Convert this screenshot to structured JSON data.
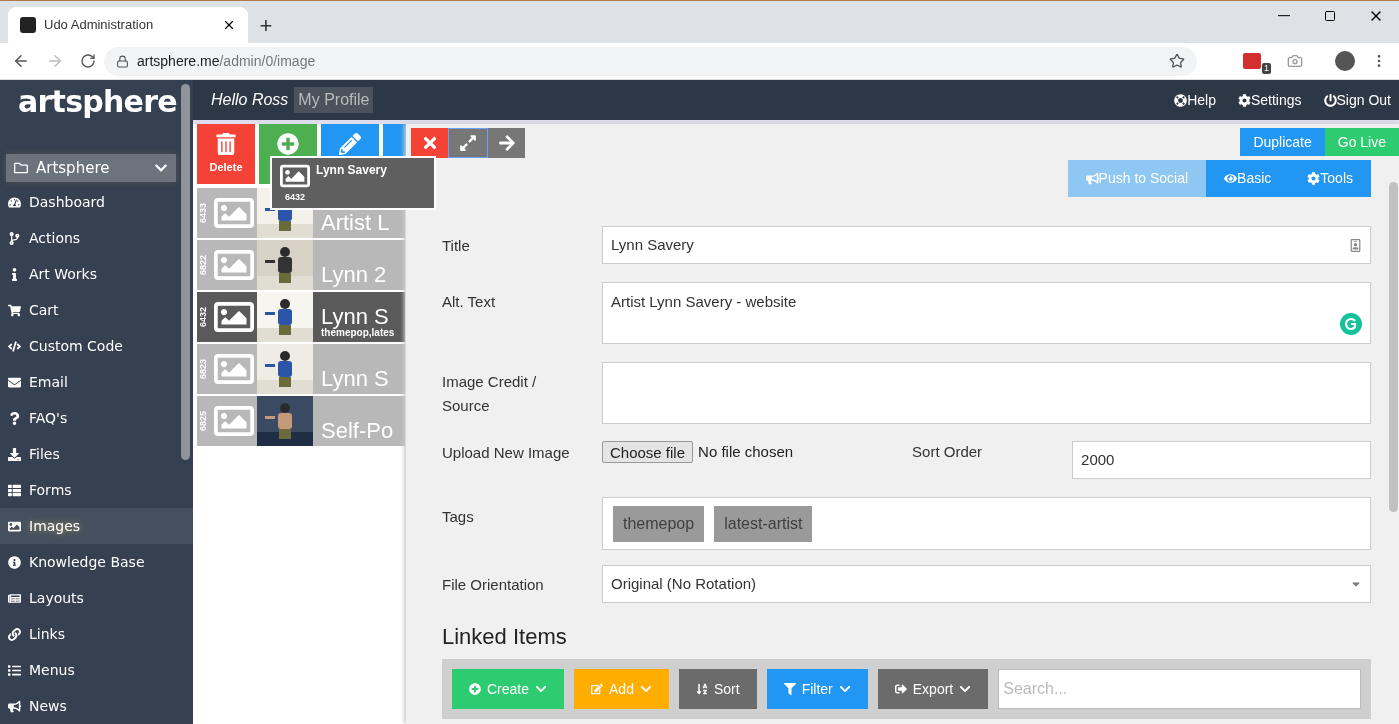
{
  "browser": {
    "tab_title": "Udo Administration",
    "new_tab": "+",
    "url_host": "artsphere.me",
    "url_path": "/admin/0/image",
    "extension_badge": "1"
  },
  "header": {
    "logo": "artsphere",
    "greeting": "Hello Ross",
    "profile_link": "My Profile",
    "actions": [
      {
        "label": "Help"
      },
      {
        "label": "Settings"
      },
      {
        "label": "Sign Out"
      }
    ]
  },
  "sidebar": {
    "workspace": "Artsphere",
    "items": [
      {
        "label": "Dashboard",
        "selected": false
      },
      {
        "label": "Actions",
        "selected": false
      },
      {
        "label": "Art Works",
        "selected": false
      },
      {
        "label": "Cart",
        "selected": false
      },
      {
        "label": "Custom Code",
        "selected": false
      },
      {
        "label": "Email",
        "selected": false
      },
      {
        "label": "FAQ's",
        "selected": false
      },
      {
        "label": "Files",
        "selected": false
      },
      {
        "label": "Forms",
        "selected": false
      },
      {
        "label": "Images",
        "selected": true
      },
      {
        "label": "Knowledge Base",
        "selected": false
      },
      {
        "label": "Layouts",
        "selected": false
      },
      {
        "label": "Links",
        "selected": false
      },
      {
        "label": "Menus",
        "selected": false
      },
      {
        "label": "News",
        "selected": false
      }
    ]
  },
  "list_toolbar": [
    {
      "kind": "delete",
      "label": "Delete"
    },
    {
      "kind": "add"
    },
    {
      "kind": "edit"
    },
    {
      "kind": "more"
    }
  ],
  "drag_preview": {
    "title": "Lynn Savery",
    "id": "6432"
  },
  "images": [
    {
      "id": "6433",
      "title": "Artist L",
      "selected": false
    },
    {
      "id": "6822",
      "title": "Lynn 2",
      "selected": false
    },
    {
      "id": "6432",
      "title": "Lynn S",
      "tags": "themepop,lates",
      "selected": true
    },
    {
      "id": "6823",
      "title": "Lynn S",
      "selected": false
    },
    {
      "id": "6825",
      "title": "Self-Po",
      "selected": false
    }
  ],
  "panel": {
    "top_buttons": [
      {
        "label": "Duplicate",
        "color": "#2196f3"
      },
      {
        "label": "Go Live",
        "color": "#2ecc71"
      }
    ],
    "tabs": [
      {
        "label": "Push to Social",
        "disabled": true
      },
      {
        "label": "Basic",
        "disabled": false
      },
      {
        "label": "Tools",
        "disabled": false
      }
    ],
    "fields": [
      {
        "kind": "text",
        "label": "Title",
        "value": "Lynn Savery"
      },
      {
        "kind": "textarea",
        "label": "Alt. Text",
        "value": "Artist Lynn Savery - website"
      },
      {
        "kind": "textarea",
        "label": "Image Credit / Source"
      },
      {
        "kind": "file",
        "label": "Upload New Image",
        "button": "Choose file",
        "status": "No file chosen",
        "side_label": "Sort Order",
        "side_value": "2000"
      },
      {
        "kind": "tags",
        "label": "Tags",
        "tags": [
          "themepop",
          "latest-artist"
        ]
      },
      {
        "kind": "select",
        "label": "File Orientation",
        "value": "Original (No Rotation)"
      }
    ],
    "linked_items": {
      "heading": "Linked Items",
      "buttons": [
        {
          "label": "Create",
          "color": "#2ecc71",
          "dropdown": true
        },
        {
          "label": "Add",
          "color": "#ffad00",
          "dropdown": true
        },
        {
          "label": "Sort",
          "color": "#6b6b6b",
          "dropdown": false
        },
        {
          "label": "Filter",
          "color": "#2196f3",
          "dropdown": true
        },
        {
          "label": "Export",
          "color": "#6b6b6b",
          "dropdown": true
        }
      ],
      "search_placeholder": "Search..."
    }
  }
}
